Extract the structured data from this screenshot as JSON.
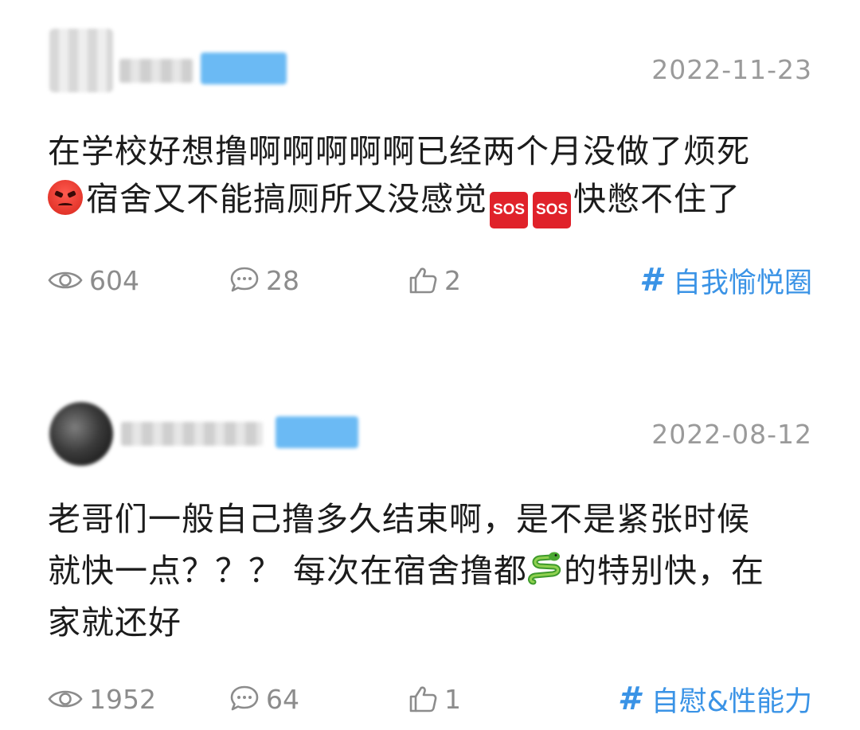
{
  "posts": [
    {
      "date": "2022-11-23",
      "content_lines": [
        "在学校好想撸啊啊啊啊啊已经两个月没做了烦死",
        "宿舍又不能搞厕所又没感觉",
        "快憋不住了"
      ],
      "sos_label": "SOS",
      "views": "604",
      "comments": "28",
      "likes": "2",
      "topic_hash": "#",
      "topic": "自我愉悦圈"
    },
    {
      "date": "2022-08-12",
      "content_lines": [
        "老哥们一般自己撸多久结束啊，是不是紧张时候",
        "就快一点？？？ 每次在宿舍撸都",
        "的特别快，在",
        "家就还好"
      ],
      "views": "1952",
      "comments": "64",
      "likes": "1",
      "topic_hash": "#",
      "topic": "自慰&性能力"
    }
  ],
  "icons": {
    "views": "eye-icon",
    "comments": "comment-bubble-icon",
    "likes": "thumbs-up-icon",
    "angry_emoji": "angry-face-icon",
    "sos_emoji": "sos-icon",
    "snake_emoji": "snake-icon"
  },
  "colors": {
    "topic": "#3a93e6",
    "meta": "#8c8c8c",
    "date": "#9a9a9a",
    "sos_bg": "#e0222a",
    "badge": "#5bb3f3"
  }
}
